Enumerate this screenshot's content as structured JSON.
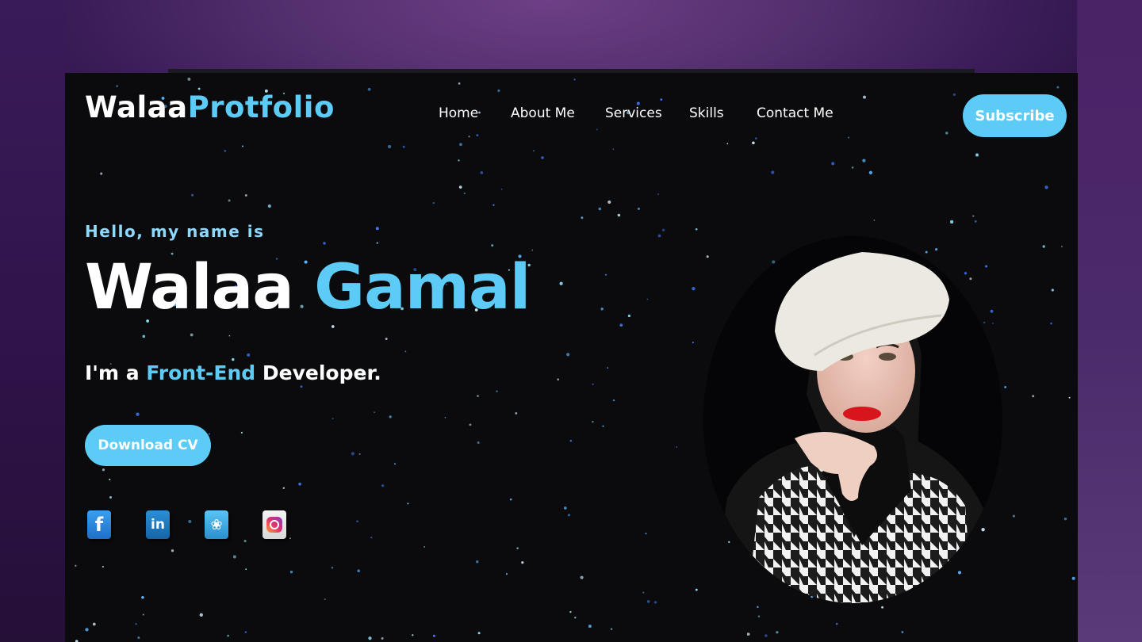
{
  "brand": {
    "first": "Walaa",
    "second": "Protfolio"
  },
  "nav": {
    "items": [
      {
        "label": "Home"
      },
      {
        "label": "About Me"
      },
      {
        "label": "Services"
      },
      {
        "label": "Skills"
      },
      {
        "label": "Contact Me"
      }
    ],
    "subscribe_label": "Subscribe"
  },
  "hero": {
    "greeting": "Hello, my name is",
    "first_name": "Walaa",
    "last_name": "Gamal",
    "role_prefix": "I'm a ",
    "role_highlight": "Front-End",
    "role_suffix": " Developer.",
    "cv_label": "Download CV"
  },
  "social": [
    {
      "name": "facebook-icon",
      "glyph": "f"
    },
    {
      "name": "linkedin-icon",
      "glyph": "in"
    },
    {
      "name": "twitter-icon",
      "glyph": "❀"
    },
    {
      "name": "instagram-icon",
      "glyph": ""
    }
  ],
  "colors": {
    "accent": "#5ccbf5",
    "background": "#0b0b0d",
    "text": "#ffffff"
  }
}
